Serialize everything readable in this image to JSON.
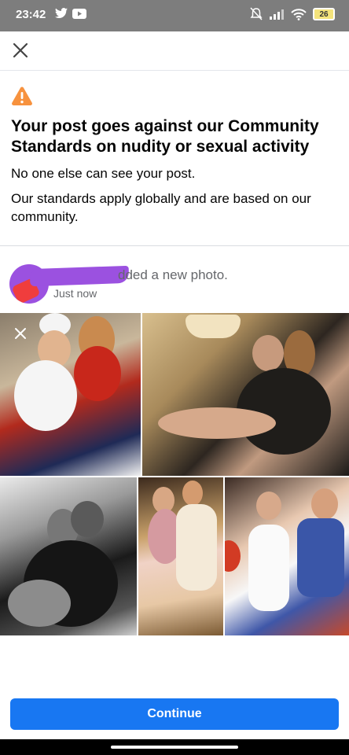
{
  "status_bar": {
    "time": "23:42",
    "battery_level": "26",
    "icons": [
      "twitter-icon",
      "youtube-icon",
      "mute-icon",
      "signal-icon",
      "wifi-icon",
      "battery-icon"
    ]
  },
  "dialog": {
    "close_icon": "close-icon",
    "warning_icon": "warning-icon",
    "title": "Your post goes against our Community Standards on nudity or sexual activity",
    "line1": "No one else can see your post.",
    "line2": "Our standards apply globally and are based on our community."
  },
  "post": {
    "action_text": "dded a new photo.",
    "timestamp": "Just now",
    "photo_count": 5
  },
  "footer": {
    "continue_label": "Continue"
  },
  "colors": {
    "accent": "#1877f2",
    "warning": "#f7923e",
    "redaction": "#9b51e0"
  }
}
